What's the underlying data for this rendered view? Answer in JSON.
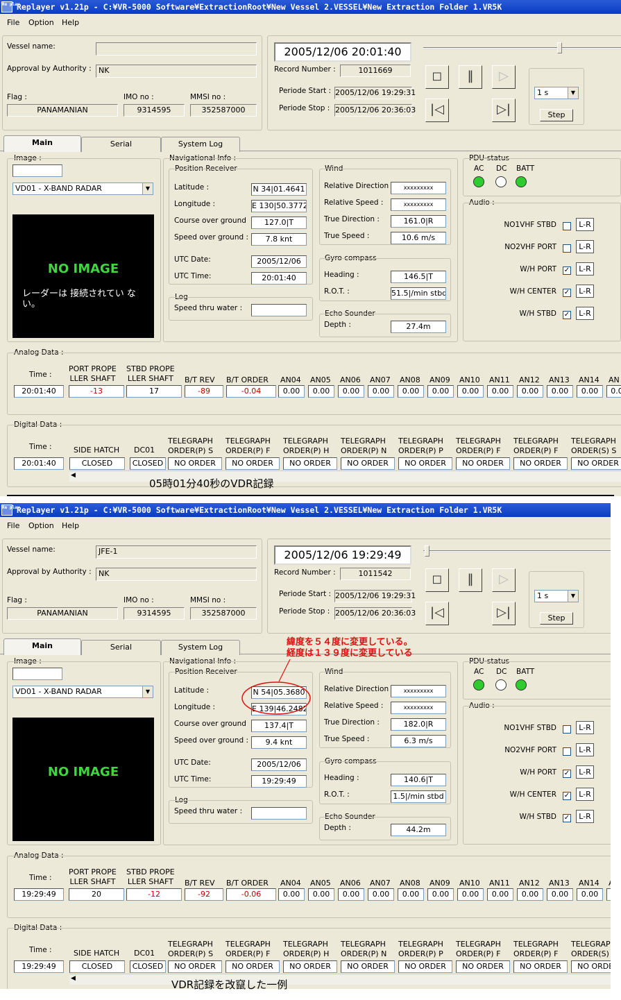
{
  "app_title": "Replayer v1.21p - C:¥VR-5000 Software¥ExtractionRoot¥New Vessel 2.VESSEL¥New Extraction Folder 1.VR5K",
  "app_icon": "Re play",
  "menu": [
    "File",
    "Option",
    "Help"
  ],
  "labels": {
    "vessel_name": "Vessel name:",
    "approval": "Approval by Authority :",
    "flag": "Flag :",
    "imo": "IMO no :",
    "mmsi": "MMSI no :",
    "record_number": "Record Number :",
    "periode_start": "Periode Start :",
    "periode_stop": "Periode Stop :",
    "step": "Step",
    "image": "Image :",
    "nav_info": "Navigational Info :",
    "position_receiver": "Position Receiver",
    "latitude": "Latitude :",
    "longitude": "Longitude :",
    "cog": "Course over ground",
    "sog": "Speed over ground :",
    "utc_date": "UTC Date:",
    "utc_time": "UTC Time:",
    "log": "Log",
    "speed_thru_water": "Speed thru water :",
    "wind": "Wind",
    "rel_dir": "Relative Direction :",
    "rel_speed": "Relative Speed :",
    "true_dir": "True Direction :",
    "true_speed": "True Speed :",
    "gyro": "Gyro compass",
    "heading": "Heading :",
    "rot": "R.O.T. :",
    "echo": "Echo Sounder",
    "depth": "Depth :",
    "pdu": "PDU-status",
    "ac": "AC",
    "dc": "DC",
    "batt": "BATT",
    "audio": "Audio :",
    "lr": "L-R",
    "analog": "Analog Data :",
    "digital": "Digital Data :",
    "time": "Time :",
    "no_image": "NO IMAGE"
  },
  "tabs": [
    "Main",
    "Serial",
    "System Log"
  ],
  "image_source": "VD01 - X-BAND RADAR",
  "step_option": "1 s",
  "audio_channels": [
    "NO1VHF STBD",
    "NO2VHF PORT",
    "W/H PORT",
    "W/H CENTER",
    "W/H STBD"
  ],
  "audio_checked": [
    false,
    false,
    true,
    true,
    true
  ],
  "pdu_leds": [
    true,
    false,
    true
  ],
  "analog_headers": [
    [
      "",
      "PORT PROPE",
      "LLER SHAFT"
    ],
    [
      "",
      "STBD PROPE",
      "LLER SHAFT"
    ],
    [
      "",
      "",
      "B/T REV"
    ],
    [
      "",
      "",
      "B/T ORDER"
    ],
    [
      "",
      "",
      "AN04"
    ],
    [
      "",
      "",
      "AN05"
    ],
    [
      "",
      "",
      "AN06"
    ],
    [
      "",
      "",
      "AN07"
    ],
    [
      "",
      "",
      "AN08"
    ],
    [
      "",
      "",
      "AN09"
    ],
    [
      "",
      "",
      "AN10"
    ],
    [
      "",
      "",
      "AN11"
    ],
    [
      "",
      "",
      "AN12"
    ],
    [
      "",
      "",
      "AN13"
    ],
    [
      "",
      "",
      "AN14"
    ],
    [
      "",
      "",
      "AN"
    ]
  ],
  "digital_headers": [
    [
      "",
      "SIDE HATCH"
    ],
    [
      "",
      "DC01"
    ],
    [
      "TELEGRAPH",
      "ORDER(P) S"
    ],
    [
      "TELEGRAPH",
      "ORDER(P) F"
    ],
    [
      "TELEGRAPH",
      "ORDER(P) H"
    ],
    [
      "TELEGRAPH",
      "ORDER(P) N"
    ],
    [
      "TELEGRAPH",
      "ORDER(P) P"
    ],
    [
      "TELEGRAPH",
      "ORDER(P) F"
    ],
    [
      "TELEGRAPH",
      "ORDER(P) F"
    ],
    [
      "TELEGRAPH",
      "ORDER(S) S"
    ]
  ],
  "digital_values": [
    "CLOSED",
    "CLOSED",
    "NO ORDER",
    "NO ORDER",
    "NO ORDER",
    "NO ORDER",
    "NO ORDER",
    "NO ORDER",
    "NO ORDER",
    "NO ORDER"
  ],
  "panels": [
    {
      "vessel_name": "",
      "approval": "NK",
      "flag": "PANAMANIAN",
      "imo": "9314595",
      "mmsi": "352587000",
      "datetime": "2005/12/06 20:01:40",
      "record_number": "1011669",
      "periode_start": "2005/12/06 19:29:31",
      "periode_stop": "2005/12/06 20:36:03",
      "latitude": "N 34|01.4641",
      "longitude": "E 130|50.3772",
      "cog": "127.0|T",
      "sog": "7.8 knt",
      "utc_date": "2005/12/06",
      "utc_time": "20:01:40",
      "stw": "",
      "rel_dir": "xxxxxxxxx",
      "rel_speed": "xxxxxxxxx",
      "true_dir": "161.0|R",
      "true_speed": "10.6 m/s",
      "heading": "146.5|T",
      "rot": "51.5|/min stbd",
      "depth": "27.4m",
      "no_image_msg": "レーダーは 接続されてい ない。",
      "analog_time": "20:01:40",
      "analog_values": [
        "-13",
        "17",
        "-89",
        "-0.04",
        "0.00",
        "0.00",
        "0.00",
        "0.00",
        "0.00",
        "0.00",
        "0.00",
        "0.00",
        "0.00",
        "0.00",
        "0.00",
        "0.0"
      ],
      "analog_red": [
        true,
        false,
        true,
        true,
        false,
        false,
        false,
        false,
        false,
        false,
        false,
        false,
        false,
        false,
        false,
        false
      ],
      "digital_time": "20:01:40",
      "caption": "05時01分40秒のVDR記録"
    },
    {
      "vessel_name": "JFE-1",
      "approval": "NK",
      "flag": "PANAMANIAN",
      "imo": "9314595",
      "mmsi": "352587000",
      "datetime": "2005/12/06 19:29:49",
      "record_number": "1011542",
      "periode_start": "2005/12/06 19:29:31",
      "periode_stop": "2005/12/06 20:36:03",
      "latitude": "N 54|05.3680",
      "longitude": "E 139|46.2482",
      "cog": "137.4|T",
      "sog": "9.4 knt",
      "utc_date": "2005/12/06",
      "utc_time": "19:29:49",
      "stw": "",
      "rel_dir": "xxxxxxxxx",
      "rel_speed": "xxxxxxxxx",
      "true_dir": "182.0|R",
      "true_speed": "6.3 m/s",
      "heading": "140.6|T",
      "rot": "1.5|/min stbd",
      "depth": "44.2m",
      "no_image_msg": "",
      "analog_time": "19:29:49",
      "analog_values": [
        "20",
        "-12",
        "-92",
        "-0.06",
        "0.00",
        "0.00",
        "0.00",
        "0.00",
        "0.00",
        "0.00",
        "0.00",
        "0.00",
        "0.00",
        "0.00",
        "0.00",
        ""
      ],
      "analog_red": [
        false,
        true,
        true,
        true,
        false,
        false,
        false,
        false,
        false,
        false,
        false,
        false,
        false,
        false,
        false,
        false
      ],
      "digital_time": "19:29:49",
      "caption": "VDR記録を改竄した一例",
      "annotation": [
        "緯度を５４度に変更している。",
        "経度は１３９度に変更している"
      ]
    }
  ],
  "colors": {
    "led_on": "#2ecc2e",
    "no_image_text": "#3ed83e",
    "annotation": "#e01010",
    "negative_value": "#c00000"
  }
}
